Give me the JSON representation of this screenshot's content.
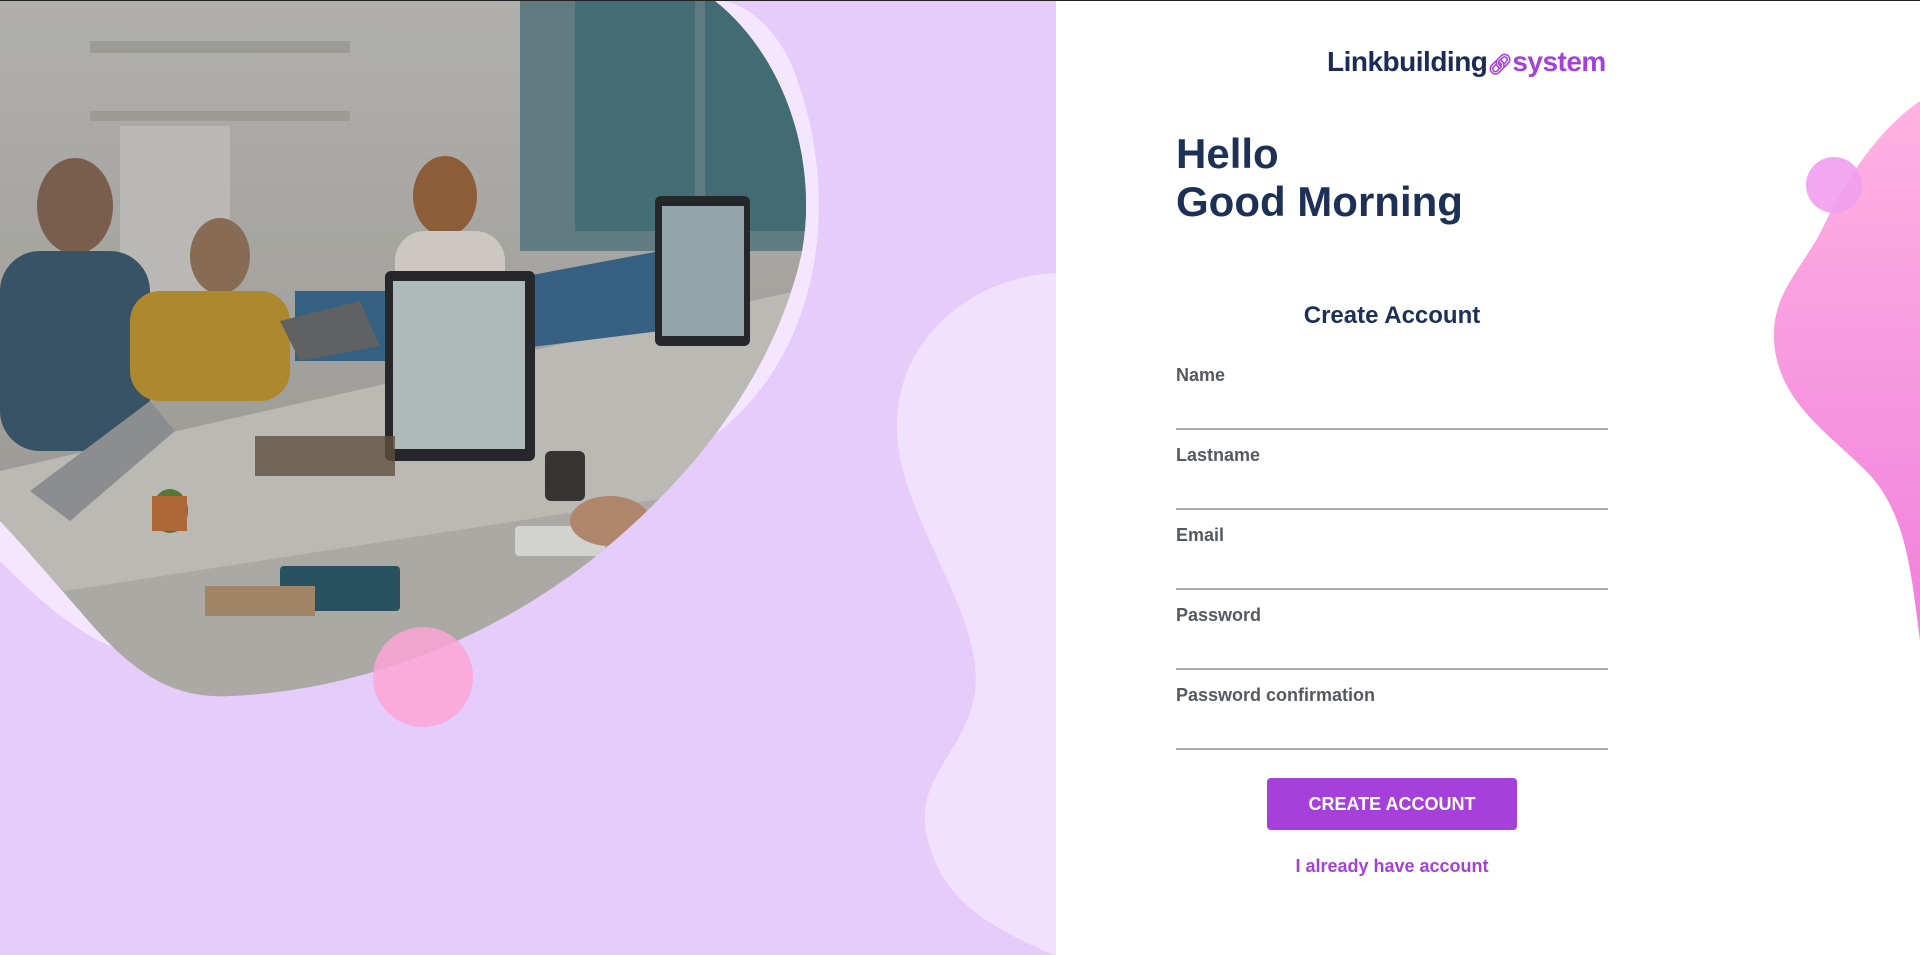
{
  "brand": {
    "name_part1": "Linkbuilding",
    "name_part2": "system",
    "link_icon": "link-icon",
    "colors": {
      "navy": "#1d2b57",
      "purple": "#a640db"
    }
  },
  "greeting": {
    "line1": "Hello",
    "line2": "Good Morning"
  },
  "form": {
    "title": "Create Account",
    "fields": [
      {
        "label": "Name",
        "value": "",
        "placeholder": ""
      },
      {
        "label": "Lastname",
        "value": "",
        "placeholder": ""
      },
      {
        "label": "Email",
        "value": "",
        "placeholder": ""
      },
      {
        "label": "Password",
        "value": "",
        "placeholder": ""
      },
      {
        "label": "Password confirmation",
        "value": "",
        "placeholder": ""
      }
    ],
    "submit_label": "CREATE ACCOUNT",
    "login_link": "I already have account"
  },
  "hero": {
    "image": "office-team-at-computers-photo"
  },
  "colors": {
    "left_background": "#e6ccfb",
    "light_blob": "#f1e1fe",
    "pink_accent": "#fca5d6",
    "right_blob": "#f59ee0"
  }
}
